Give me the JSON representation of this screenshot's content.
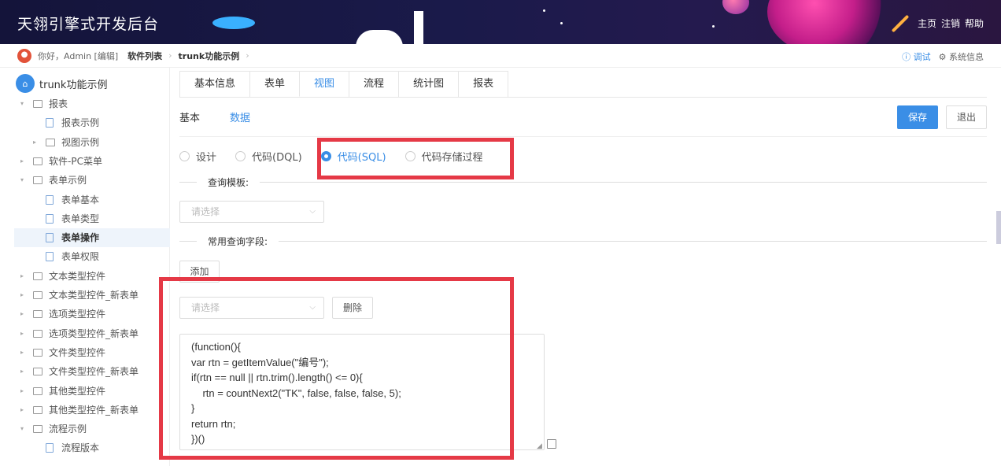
{
  "app": {
    "title": "天翎引擎式开发后台"
  },
  "header_links": [
    "主页",
    "注销",
    "帮助"
  ],
  "breadcrumb": {
    "user": "你好，Admin [编辑]",
    "items": [
      "软件列表",
      "trunk功能示例"
    ],
    "right": {
      "debug": "ⓘ 调试",
      "sysinfo": "⚙ 系统信息"
    }
  },
  "sidebar": {
    "root": "trunk功能示例",
    "items": [
      {
        "label": "报表",
        "kind": "folder",
        "expanded": true
      },
      {
        "label": "报表示例",
        "kind": "doc"
      },
      {
        "label": "视图示例",
        "kind": "folder",
        "expanded": false
      },
      {
        "label": "软件-PC菜单",
        "kind": "folder",
        "expanded": false
      },
      {
        "label": "表单示例",
        "kind": "folder",
        "expanded": true
      },
      {
        "label": "表单基本",
        "kind": "doc"
      },
      {
        "label": "表单类型",
        "kind": "doc"
      },
      {
        "label": "表单操作",
        "kind": "doc",
        "active": true
      },
      {
        "label": "表单权限",
        "kind": "doc"
      },
      {
        "label": "文本类型控件",
        "kind": "folder"
      },
      {
        "label": "文本类型控件_新表单",
        "kind": "folder"
      },
      {
        "label": "选项类型控件",
        "kind": "folder"
      },
      {
        "label": "选项类型控件_新表单",
        "kind": "folder"
      },
      {
        "label": "文件类型控件",
        "kind": "folder"
      },
      {
        "label": "文件类型控件_新表单",
        "kind": "folder"
      },
      {
        "label": "其他类型控件",
        "kind": "folder"
      },
      {
        "label": "其他类型控件_新表单",
        "kind": "folder"
      },
      {
        "label": "流程示例",
        "kind": "folder",
        "expanded": true
      },
      {
        "label": "流程版本",
        "kind": "doc"
      }
    ]
  },
  "tabs": [
    "基本信息",
    "表单",
    "视图",
    "流程",
    "统计图",
    "报表"
  ],
  "active_tab": "视图",
  "subtabs": [
    "基本",
    "数据"
  ],
  "active_subtab": "数据",
  "buttons": {
    "save": "保存",
    "exit": "退出",
    "add": "添加",
    "delete": "删除"
  },
  "radios": [
    "设计",
    "代码(DQL)",
    "代码(SQL)",
    "代码存储过程"
  ],
  "radio_selected": "代码(SQL)",
  "sections": {
    "query_template": "查询模板:",
    "common_fields": "常用查询字段:"
  },
  "select_placeholder": "请选择",
  "code": "(function(){\nvar rtn = getItemValue(\"编号\");\nif(rtn == null || rtn.trim().length() <= 0){\n    rtn = countNext2(\"TK\", false, false, false, 5);\n}\nreturn rtn;\n})()",
  "colors": {
    "accent": "#3a8ee6",
    "highlight": "#e53946",
    "header_bg": "#14143a"
  }
}
